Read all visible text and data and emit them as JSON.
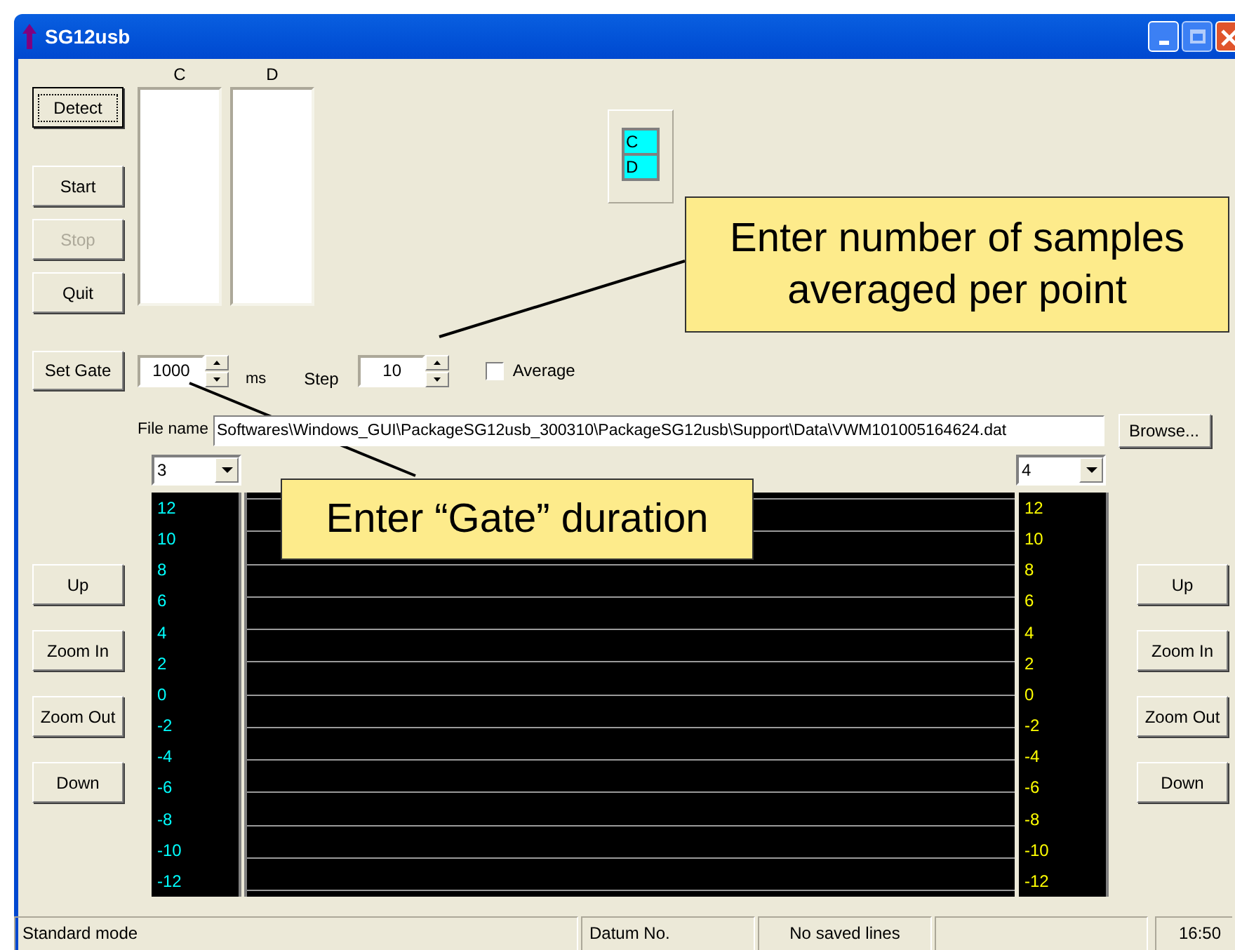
{
  "window": {
    "title": "SG12usb"
  },
  "control_buttons": [
    {
      "label": "Detect",
      "disabled": false,
      "focused": true
    },
    {
      "label": "Start",
      "disabled": false,
      "focused": false
    },
    {
      "label": "Stop",
      "disabled": true,
      "focused": false
    },
    {
      "label": "Quit",
      "disabled": false,
      "focused": false
    }
  ],
  "lists": [
    {
      "heading": "C"
    },
    {
      "heading": "D"
    }
  ],
  "channel_legend": [
    "C",
    "D"
  ],
  "gate": {
    "button": "Set Gate",
    "value": "1000",
    "unit": "ms"
  },
  "step": {
    "label": "Step",
    "value": "10"
  },
  "average": {
    "label": "Average",
    "checked": false
  },
  "file": {
    "label": "File name",
    "value": "Softwares\\Windows_GUI\\PackageSG12usb_300310\\PackageSG12usb\\Support\\Data\\VWM101005164624.dat",
    "button": "Browse..."
  },
  "axes": [
    {
      "combo": "3",
      "color": "#00ffff",
      "ticks": [
        "12",
        "10",
        "8",
        "6",
        "4",
        "2",
        "0",
        "-2",
        "-4",
        "-6",
        "-8",
        "-10",
        "-12"
      ]
    },
    {
      "combo": "4",
      "color": "#ffff00",
      "ticks": [
        "12",
        "10",
        "8",
        "6",
        "4",
        "2",
        "0",
        "-2",
        "-4",
        "-6",
        "-8",
        "-10",
        "-12"
      ]
    }
  ],
  "side_buttons": [
    [
      "Up",
      "Zoom In",
      "Zoom Out",
      "Down"
    ],
    [
      "Up",
      "Zoom In",
      "Zoom Out",
      "Down"
    ]
  ],
  "status_bar": {
    "mode": "Standard mode",
    "datum": "Datum No.",
    "saved": "No saved lines",
    "time": "16:50"
  },
  "callouts": [
    {
      "text": "Enter number of samples averaged per point"
    },
    {
      "text": "Enter “Gate” duration"
    }
  ]
}
